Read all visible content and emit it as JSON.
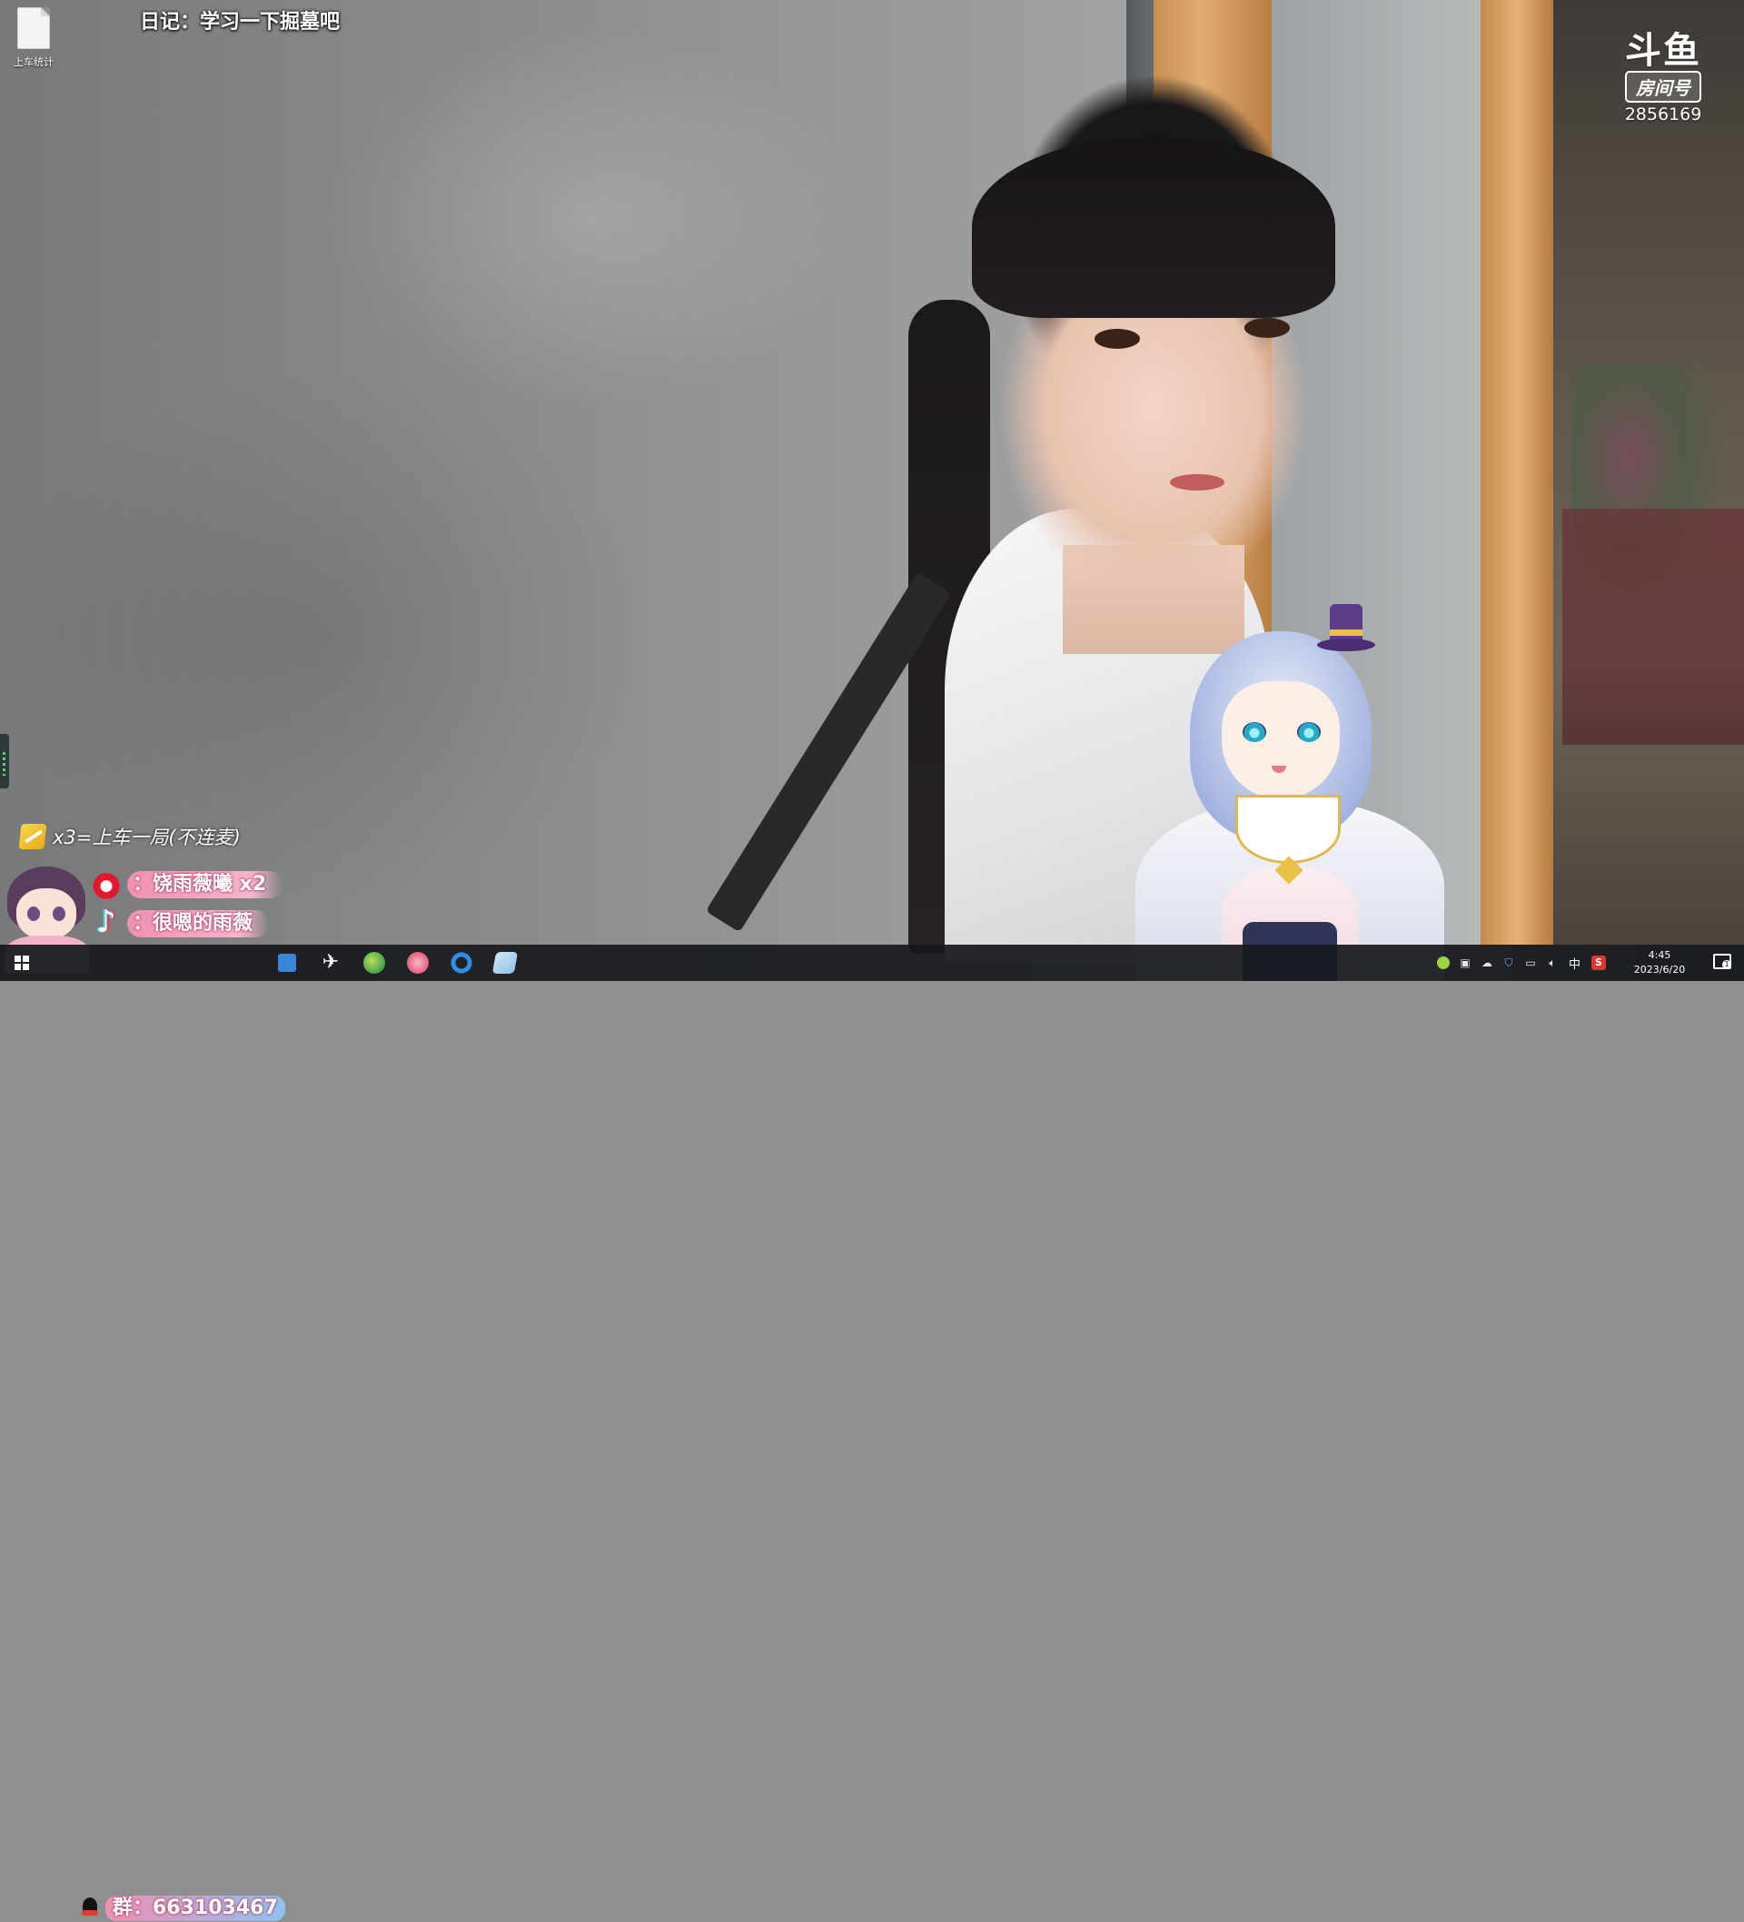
{
  "desktop": {
    "icons": [
      {
        "label": "上车统计",
        "icon": "text-file-icon"
      }
    ]
  },
  "overlay": {
    "title": "日记：学习一下掘墓吧",
    "douyu": {
      "logo": "斗鱼",
      "room_label": "房间号",
      "room_id": "2856169"
    },
    "rule": {
      "text": "x3=上车一局(不连麦)",
      "icon": "ticket-icon"
    },
    "socials": [
      {
        "icon": "weibo-icon",
        "text": "：饶雨薇曦 x2"
      },
      {
        "icon": "tiktok-icon",
        "text": "：很嗯的雨薇"
      }
    ],
    "qq_group": "群：663103467"
  },
  "taskbar": {
    "apps": [
      {
        "name": "feishu-icon",
        "active": false
      },
      {
        "name": "globe-browser-icon",
        "active": false
      },
      {
        "name": "bilibili-icon",
        "active": false
      },
      {
        "name": "browser-icon",
        "active": false
      },
      {
        "name": "notes-icon",
        "active": false
      }
    ],
    "tray": {
      "ime": "中",
      "sogou": "S",
      "time": "4:45",
      "date": "2023/6/20",
      "notifications": "1"
    }
  },
  "colors": {
    "pink_pill": "#f08fb1",
    "taskbar": "#16181c",
    "accent": "#76b9ed"
  }
}
